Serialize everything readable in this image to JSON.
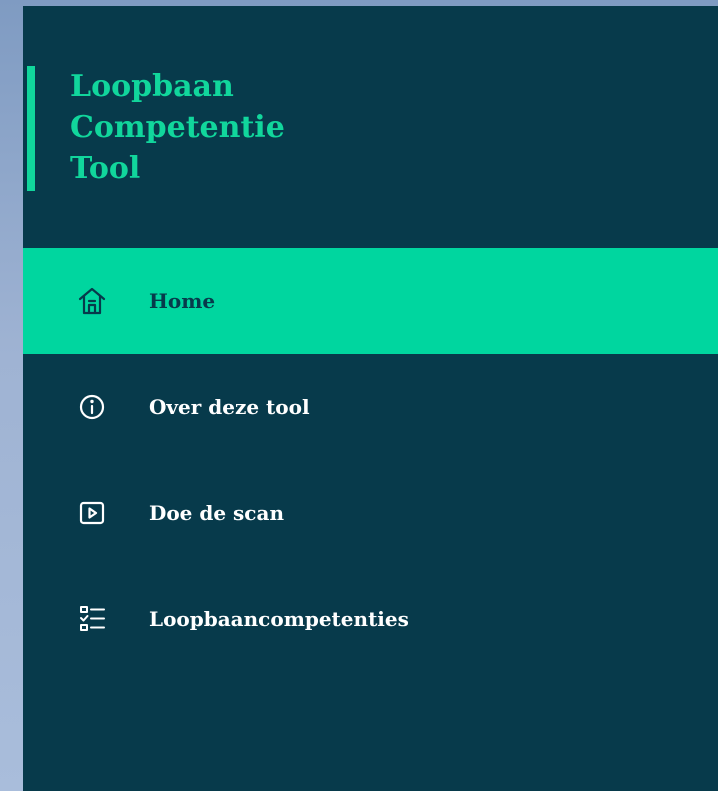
{
  "brand": {
    "lines": [
      "Loopbaan",
      "Competentie",
      "Tool"
    ]
  },
  "nav": {
    "items": [
      {
        "label": "Home",
        "icon": "home-icon",
        "active": true
      },
      {
        "label": "Over deze tool",
        "icon": "info-icon",
        "active": false
      },
      {
        "label": "Doe de scan",
        "icon": "play-icon",
        "active": false
      },
      {
        "label": "Loopbaancompetenties",
        "icon": "checklist-icon",
        "active": false
      }
    ]
  },
  "colors": {
    "sidebar_bg": "#073a4b",
    "accent": "#00d69f",
    "brand_text": "#11d69c",
    "nav_text": "#ffffff",
    "active_text": "#073a4b"
  }
}
